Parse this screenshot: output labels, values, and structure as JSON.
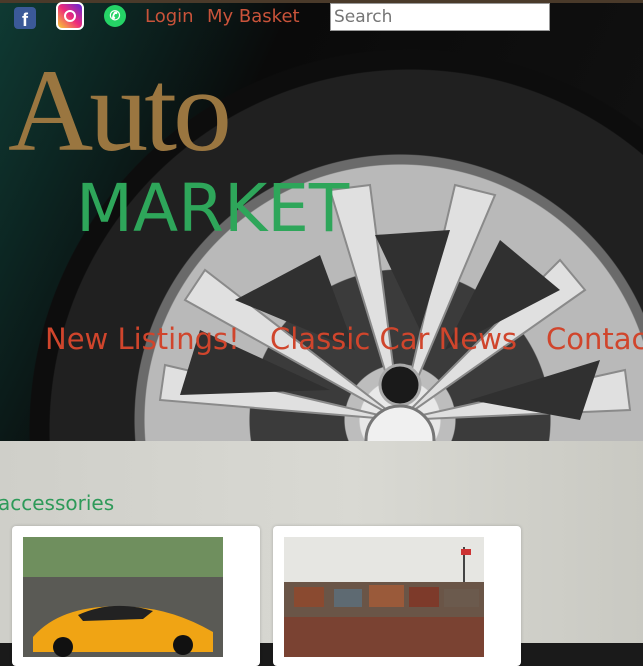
{
  "topbar": {
    "login": "Login",
    "basket": "My Basket",
    "search_placeholder": "Search",
    "social": [
      "facebook-icon",
      "instagram-icon",
      "whatsapp-icon"
    ]
  },
  "logo": {
    "line1": "Auto",
    "line2": "MARKET"
  },
  "nav": {
    "items": [
      "New Listings!",
      "Classic Car News",
      "Contac"
    ]
  },
  "section": {
    "title": "accessories"
  },
  "colors": {
    "link": "#c9533a",
    "nav": "#d0452c",
    "logo_auto": "#9a7640",
    "logo_market": "#2ea65a",
    "section_title": "#2e9a59"
  }
}
